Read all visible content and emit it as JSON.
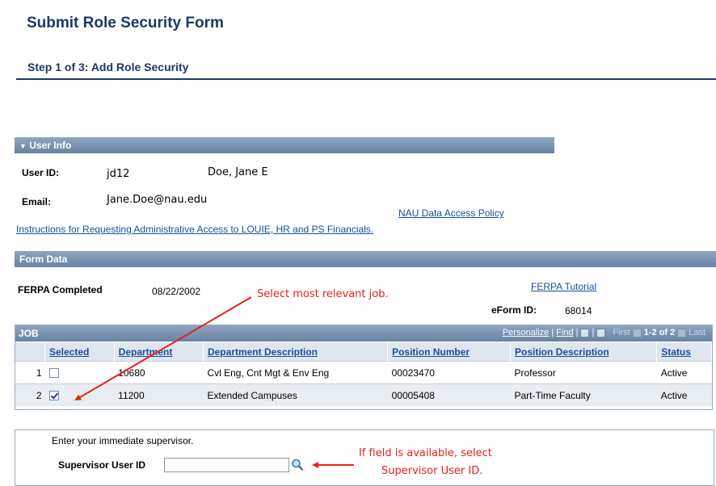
{
  "header": {
    "title": "Submit Role Security Form",
    "step": "Step 1 of 3: Add Role Security"
  },
  "user_info": {
    "section_label": "User Info",
    "user_id_label": "User ID:",
    "user_id": "jd12",
    "name": "Doe, Jane E",
    "email_label": "Email:",
    "email": "Jane.Doe@nau.edu",
    "policy_link": "NAU Data Access Policy",
    "instructions_link": "Instructions for Requesting Administrative Access to LOUIE, HR and PS Financials."
  },
  "form_data": {
    "section_label": "Form Data",
    "ferpa_label": "FERPA Completed",
    "ferpa_date": "08/22/2002",
    "ferpa_tutorial_link": "FERPA Tutorial",
    "eform_label": "eForm ID:",
    "eform_id": "68014"
  },
  "annotations": {
    "select_job": "Select most relevant job.",
    "supervisor_line1": "If field is available, select",
    "supervisor_line2": "Supervisor User ID."
  },
  "job_grid": {
    "title": "JOB",
    "personalize": "Personalize",
    "find": "Find",
    "first": "First",
    "range": "1-2 of 2",
    "last": "Last",
    "columns": [
      "Selected",
      "Department",
      "Department Description",
      "Position Number",
      "Position Description",
      "Status"
    ],
    "rows": [
      {
        "num": "1",
        "selected": false,
        "department": "10680",
        "dept_desc": "Cvl Eng, Cnt Mgt & Env Eng",
        "position_number": "00023470",
        "position_desc": "Professor",
        "status": "Active"
      },
      {
        "num": "2",
        "selected": true,
        "department": "11200",
        "dept_desc": "Extended Campuses",
        "position_number": "00005408",
        "position_desc": "Part-Time Faculty",
        "status": "Active"
      }
    ]
  },
  "supervisor": {
    "prompt": "Enter your immediate supervisor.",
    "label": "Supervisor User ID",
    "value": ""
  },
  "colors": {
    "title": "#1f3864",
    "section_bar": "#6882a3",
    "link": "#1a4d9c",
    "annotation": "#e8201a"
  }
}
